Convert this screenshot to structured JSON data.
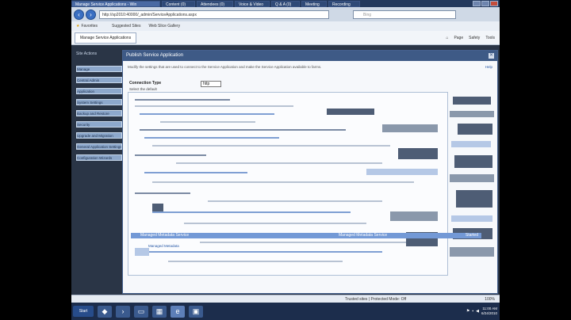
{
  "browser": {
    "window_title": "Manage Service Applications - Windows Internet Explorer",
    "tabs": [
      {
        "label": "Manage Service Applications - Win",
        "active": true
      },
      {
        "label": "Content (0)",
        "active": false
      },
      {
        "label": "Attendees (0)",
        "active": false
      },
      {
        "label": "Voice & Video",
        "active": false
      },
      {
        "label": "Q & A (0)",
        "active": false
      },
      {
        "label": "Meeting",
        "active": false
      },
      {
        "label": "Recording",
        "active": false
      }
    ],
    "address": "http://sp2010:40000/_admin/ServiceApplications.aspx",
    "search_placeholder": "Bing",
    "favorites": {
      "label": "Favorites",
      "items": [
        "Suggested Sites",
        "Web Slice Gallery"
      ]
    },
    "page_tab": "Manage Service Applications",
    "commands": [
      "Page",
      "Safety",
      "Tools"
    ],
    "status_zone": "Trusted sites | Protected Mode: Off",
    "zoom": "100%"
  },
  "sharepoint": {
    "top_left": "Site Actions",
    "left_links": [
      "Manage",
      "Central Admin",
      "Application",
      "System Settings",
      "Backup and Restore",
      "Security",
      "Upgrade and Migration",
      "General Application Settings",
      "Configuration Wizards"
    ]
  },
  "dialog": {
    "title": "Publish Service Application",
    "intro": "Modify the settings that are used to connect to the Service Application and make the Service Application available to farms.",
    "help": "Help",
    "connection_type_label": "Connection Type",
    "connection_type_sub": "Select the default",
    "connection_type_value": "http",
    "selected_row": {
      "name": "Managed Metadata Service",
      "type": "Managed Metadata Service",
      "status": "Started"
    },
    "next_row": "Managed Metadata"
  },
  "taskbar": {
    "start": "Start",
    "time": "11:00 AM",
    "date": "6/24/2010"
  },
  "colors": {
    "title_bar": "#23395d",
    "dialog_header": "#3e5a86",
    "selection": "#7399d6",
    "taskbar": "#1c2d4c"
  }
}
